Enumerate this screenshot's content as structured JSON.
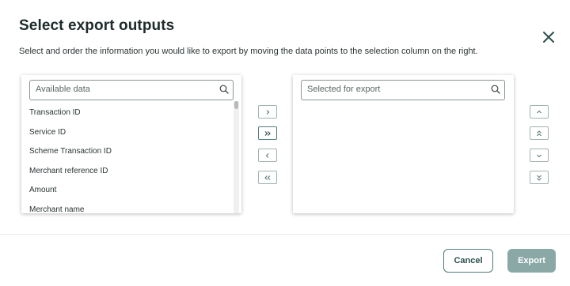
{
  "dialog": {
    "title": "Select export outputs",
    "subtitle": "Select and order the information you would like to export by moving the data points to the selection column on the right.",
    "close_icon": "close-icon"
  },
  "available": {
    "search_placeholder": "Available data",
    "items": [
      "Transaction ID",
      "Service ID",
      "Scheme Transaction ID",
      "Merchant reference ID",
      "Amount",
      "Merchant name"
    ]
  },
  "selected": {
    "search_placeholder": "Selected for export",
    "items": []
  },
  "transfer_controls": {
    "move_right": "chevron-right-icon",
    "move_all_right": "double-chevron-right-icon",
    "move_left": "chevron-left-icon",
    "move_all_left": "double-chevron-left-icon"
  },
  "order_controls": {
    "move_up": "chevron-up-icon",
    "move_to_top": "double-chevron-up-icon",
    "move_down": "chevron-down-icon",
    "move_to_bottom": "double-chevron-down-icon"
  },
  "footer": {
    "cancel_label": "Cancel",
    "export_label": "Export"
  },
  "colors": {
    "accent": "#4f7e7a",
    "export_disabled": "#8aa9a6",
    "control_border": "#9fb3b1"
  }
}
